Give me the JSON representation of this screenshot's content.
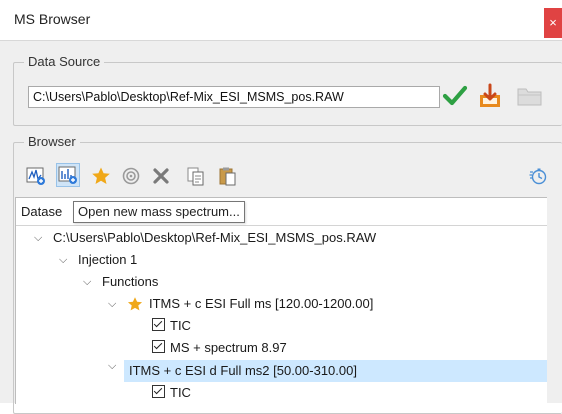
{
  "window": {
    "title": "MS Browser",
    "close_glyph": "×"
  },
  "data_source": {
    "legend": "Data Source",
    "path": "C:\\Users\\Pablo\\Desktop\\Ref-Mix_ESI_MSMS_pos.RAW",
    "buttons": [
      "checkmark-icon",
      "import-icon",
      "folder-icon"
    ]
  },
  "browser": {
    "legend": "Browser",
    "toolbar": [
      "open-chromatogram-icon",
      "open-mass-spectrum-icon",
      "favorite-star-icon",
      "target-icon",
      "delete-icon",
      "copy-icon",
      "paste-icon",
      "refresh-timer-icon"
    ],
    "header": "Datase",
    "tooltip": "Open new mass spectrum...",
    "tree": {
      "file": "C:\\Users\\Pablo\\Desktop\\Ref-Mix_ESI_MSMS_pos.RAW",
      "injection": "Injection 1",
      "functions": "Functions",
      "func1": "ITMS + c ESI Full ms [120.00-1200.00]",
      "func1_tic": "TIC",
      "func1_ms": "MS + spectrum 8.97",
      "func2": "ITMS + c ESI d Full ms2 [50.00-310.00]",
      "func2_tic": "TIC"
    }
  },
  "colors": {
    "selection": "#cde8ff",
    "accent_green": "#2ea043",
    "accent_orange": "#e8891c",
    "star": "#f0a818"
  }
}
